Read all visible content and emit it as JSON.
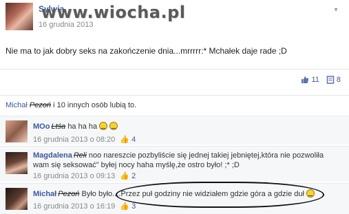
{
  "post": {
    "author": "Sylwia",
    "watermark": "www.wiocha.pl",
    "timestamp": "16 grudnia 2013",
    "text": "Nie ma to jak dobry seks na zakończenie dnia...mrrrrr:* Mchałek daje rade ;D",
    "like_count": "11",
    "comment_count": "8"
  },
  "likes": {
    "name": "Michał",
    "scribbled": "Pezoń",
    "rest": " i 10 innych osób lubią to."
  },
  "comments": [
    {
      "name": "MOo",
      "scribbled": "Ltśa",
      "text": "ha ha ha",
      "time": "16 grudnia 2013 o 08:20",
      "likes": "4"
    },
    {
      "name": "Magdalena",
      "scribbled": "Reli",
      "text": "noo nareszcie pozbyliście się jednej takiej jebniętej,która nie pozwoliła wam się seksować\" byłej nocy haha myślę,że ostro było! ;* ;D",
      "time": "16 grudnia 2013 o 09:13",
      "likes": "2"
    },
    {
      "name": "Michał",
      "scribbled": "Pezoń",
      "text": "Było było....Przez puł godziny nie widziałem gdzie góra a gdzie duł",
      "time": "16 grudnia 2013 o 16:19",
      "likes": "3"
    }
  ],
  "colors": {
    "link": "#3b5998",
    "muted": "#888888",
    "comment_bg": "#f6f7f9"
  }
}
